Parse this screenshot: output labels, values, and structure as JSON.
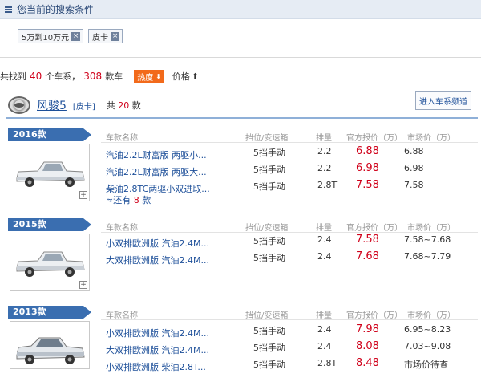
{
  "search": {
    "title": "您当前的搜索条件",
    "tags": [
      "5万到10万元",
      "皮卡"
    ],
    "tag_close": "×"
  },
  "summary": {
    "prefix": "共找到",
    "series_count": "40",
    "mid": "个车系，",
    "model_count": "308",
    "suffix": "款车",
    "hot_label": "热度",
    "hot_arrow": "⬇",
    "price_label": "价格",
    "price_arrow": "⬆"
  },
  "brand": {
    "name": "风骏5",
    "type": "[皮卡]",
    "count_prefix": "共",
    "count": "20",
    "count_suffix": "款",
    "enter_label": "进入车系频道"
  },
  "columns": {
    "name": "车款名称",
    "trans": "挡位/变速箱",
    "disp": "排量",
    "price": "官方报价（万）",
    "market": "市场价（万）"
  },
  "plus": "+",
  "years": [
    {
      "label": "2016款",
      "rows": [
        {
          "bullet": "·",
          "name": "汽油2.2L财富版 两驱小...",
          "trans": "5挡手动",
          "disp": "2.2",
          "price": "6.88",
          "market": "6.88"
        },
        {
          "bullet": "·",
          "name": "汽油2.2L财富版 两驱大...",
          "trans": "5挡手动",
          "disp": "2.2",
          "price": "6.98",
          "market": "6.98"
        },
        {
          "bullet": "·",
          "name": "柴油2.8TC两驱小双进取...",
          "trans": "5挡手动",
          "disp": "2.8T",
          "price": "7.58",
          "market": "7.58"
        }
      ],
      "more": {
        "prefix": "≈还有",
        "count": "8",
        "suffix": "款"
      }
    },
    {
      "label": "2015款",
      "rows": [
        {
          "bullet": "·",
          "name": "小双排欧洲版 汽油2.4M...",
          "trans": "5挡手动",
          "disp": "2.4",
          "price": "7.58",
          "market": "7.58~7.68"
        },
        {
          "bullet": "·",
          "name": "大双排欧洲版 汽油2.4M...",
          "trans": "5挡手动",
          "disp": "2.4",
          "price": "7.68",
          "market": "7.68~7.79"
        }
      ]
    },
    {
      "label": "2013款",
      "rows": [
        {
          "bullet": "·",
          "name": "小双排欧洲版 汽油2.4M...",
          "trans": "5挡手动",
          "disp": "2.4",
          "price": "7.98",
          "market": "6.95~8.23"
        },
        {
          "bullet": "·",
          "name": "大双排欧洲版 汽油2.4M...",
          "trans": "5挡手动",
          "disp": "2.4",
          "price": "8.08",
          "market": "7.03~9.08"
        },
        {
          "bullet": "·",
          "name": "小双排欧洲版 柴油2.8T...",
          "trans": "5挡手动",
          "disp": "2.8T",
          "price": "8.48",
          "market": "市场价待查"
        }
      ]
    }
  ]
}
